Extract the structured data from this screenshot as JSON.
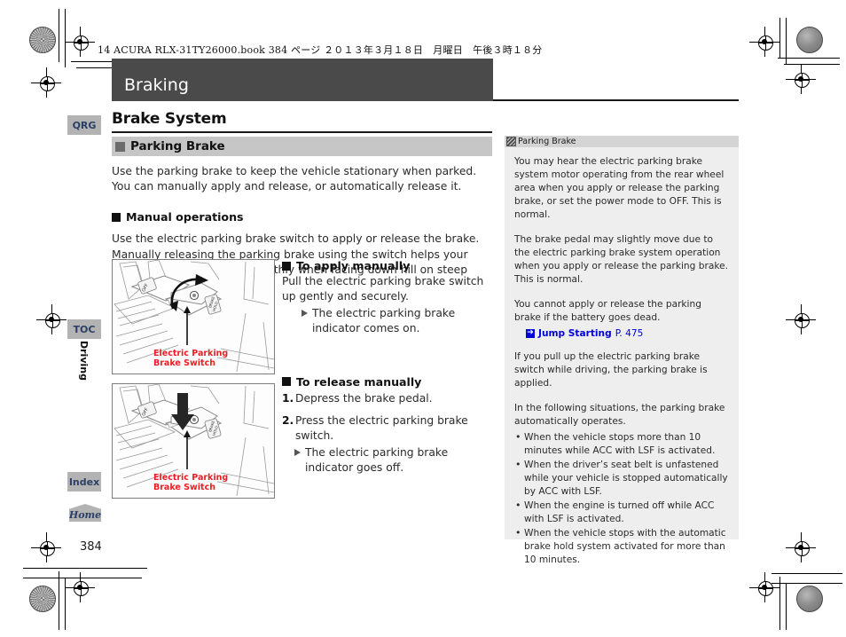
{
  "running_header": "14 ACURA RLX-31TY26000.book  384 ページ  ２０１３年３月１８日　月曜日　午後３時１８分",
  "chapter_title": "Braking",
  "page_number": "384",
  "side_tabs": {
    "qrg": "QRG",
    "toc": "TOC",
    "index": "Index",
    "home": "Home",
    "vertical_label": "Driving"
  },
  "main": {
    "section_title": "Brake System",
    "subsection_title": "Parking Brake",
    "intro": "Use the parking brake to keep the vehicle stationary when parked. You can manually apply and release, or automatically release it.",
    "manual_operations_heading": "Manual operations",
    "manual_operations_body": "Use the electric parking brake switch to apply or release the brake. Manually releasing the parking brake using the switch helps your vehicle start slowly and smoothly when facing down hill on steep hills.",
    "apply": {
      "heading": "To apply manually",
      "body": "Pull the electric parking brake switch up gently and securely.",
      "result": "The electric parking brake indicator comes on."
    },
    "release": {
      "heading": "To release manually",
      "step1_num": "1.",
      "step1": "Depress the brake pedal.",
      "step2_num": "2.",
      "step2": "Press the electric parking brake switch.",
      "result": "The electric parking brake indicator goes off."
    },
    "figure_caption_line1": "Electric Parking",
    "figure_caption_line2": "Brake Switch",
    "switch_labels": {
      "left": "OFF",
      "right": "BRAKE HOLD"
    }
  },
  "note_panel": {
    "header": "Parking Brake",
    "paragraphs": [
      "You may hear the electric parking brake system motor operating from the rear wheel area when you apply or release the parking brake, or set the power mode to OFF. This is normal.",
      "The brake pedal may slightly move due to the electric parking brake system operation when you apply or release the parking brake. This is normal.",
      "You cannot apply or release the parking brake if the battery goes dead."
    ],
    "jump_link": "Jump Starting",
    "jump_page": "P. 475",
    "paragraph_after_link": "If you pull up the electric parking brake switch while driving, the parking brake is applied.",
    "auto_intro": "In the following situations, the parking brake automatically operates.",
    "auto_bullets": [
      "When the vehicle stops more than 10 minutes while ACC with LSF is activated.",
      "When the driver’s seat belt is unfastened while your vehicle is stopped automatically by ACC with LSF.",
      "When the engine is turned off while ACC with LSF is activated.",
      "When the vehicle stops with the automatic brake hold system activated for more than 10 minutes."
    ]
  },
  "colors": {
    "title_bar": "#4a4a4a",
    "subsection_bar": "#c6c6c6",
    "note_panel": "#eeeeee",
    "tab": "#b3b3b3",
    "tab_text": "#2c3f66",
    "caption_red": "#ed1c24",
    "link_blue": "#0000d8"
  }
}
